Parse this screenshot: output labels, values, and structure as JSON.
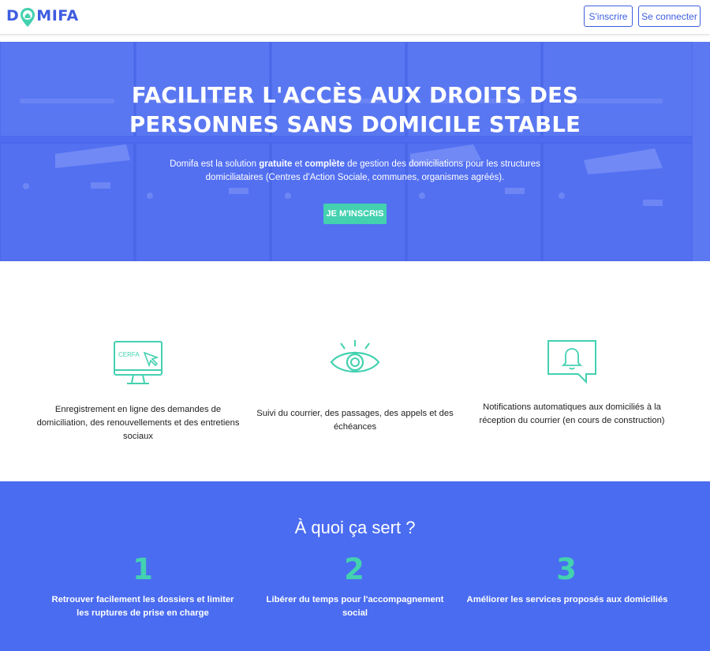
{
  "brand": {
    "name_prefix": "D",
    "name_suffix": "MIFA",
    "color": "#3e5de0",
    "accent": "#43d1b0"
  },
  "header": {
    "signup_label": "S'inscrire",
    "login_label": "Se connecter"
  },
  "hero": {
    "title_line1": "FACILITER L'ACCÈS AUX DROITS DES",
    "title_line2": "PERSONNES SANS DOMICILE STABLE",
    "desc_part1": "Domifa est la solution ",
    "desc_bold1": "gratuite",
    "desc_part2": " et ",
    "desc_bold2": "complète",
    "desc_part3": " de gestion des domiciliations pour les structures domiciliataires (Centres d'Action Sociale, communes, organismes agréés).",
    "cta_label": "JE M'INSCRIS",
    "overlay_color": "#4f6ef2"
  },
  "features": [
    {
      "icon": "computer-cerfa-icon",
      "icon_text": "CERFA",
      "text": "Enregistrement en ligne des demandes de domiciliation, des renouvellements et des entretiens sociaux"
    },
    {
      "icon": "eye-icon",
      "text": "Suivi du courrier, des passages, des appels et des échéances"
    },
    {
      "icon": "notification-bell-icon",
      "text": "Notifications automatiques aux domiciliés à la réception du courrier (en cours de construction)"
    }
  ],
  "purpose": {
    "title": "À quoi ça sert ?",
    "items": [
      {
        "number": "1",
        "text": "Retrouver facilement les dossiers et limiter les ruptures de prise en charge"
      },
      {
        "number": "2",
        "text": "Libérer du temps pour l'accompagnement social"
      },
      {
        "number": "3",
        "text": "Améliorer les services proposés aux domiciliés"
      }
    ],
    "bg_color": "#4a6cf1"
  }
}
